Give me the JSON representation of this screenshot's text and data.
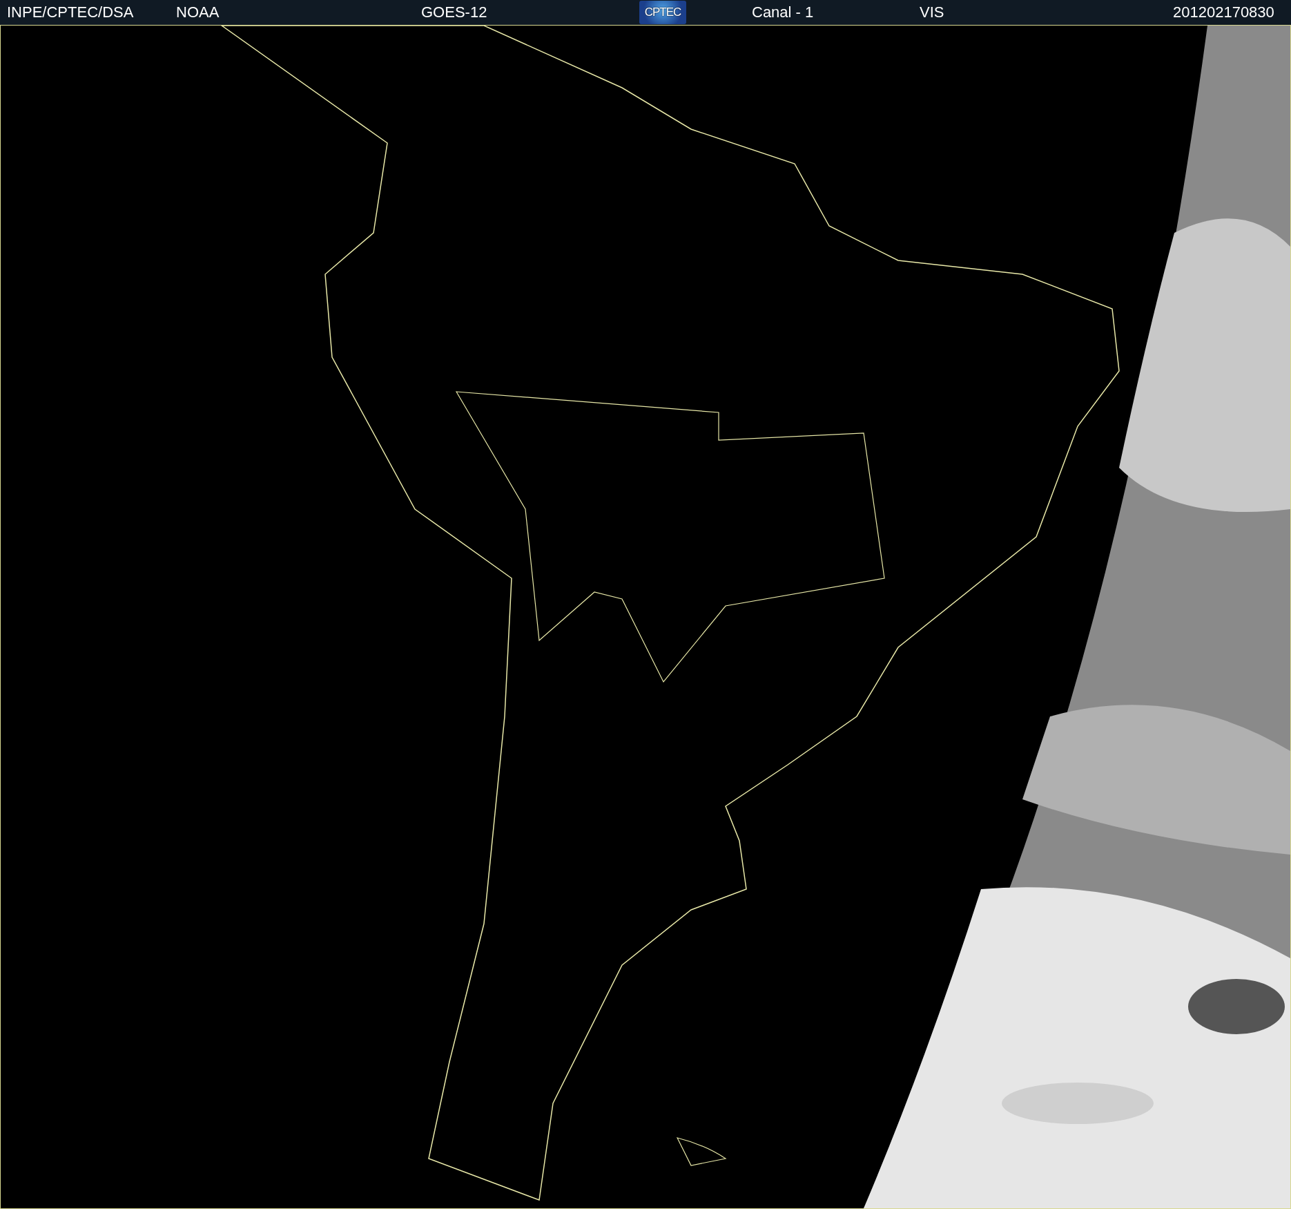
{
  "header": {
    "items": [
      "INPE/CPTEC/DSA",
      "NOAA",
      "GOES-12"
    ],
    "logo": "CPTEC",
    "channel": "Canal - 1",
    "band": "VIS",
    "timestamp": "201202170830"
  }
}
